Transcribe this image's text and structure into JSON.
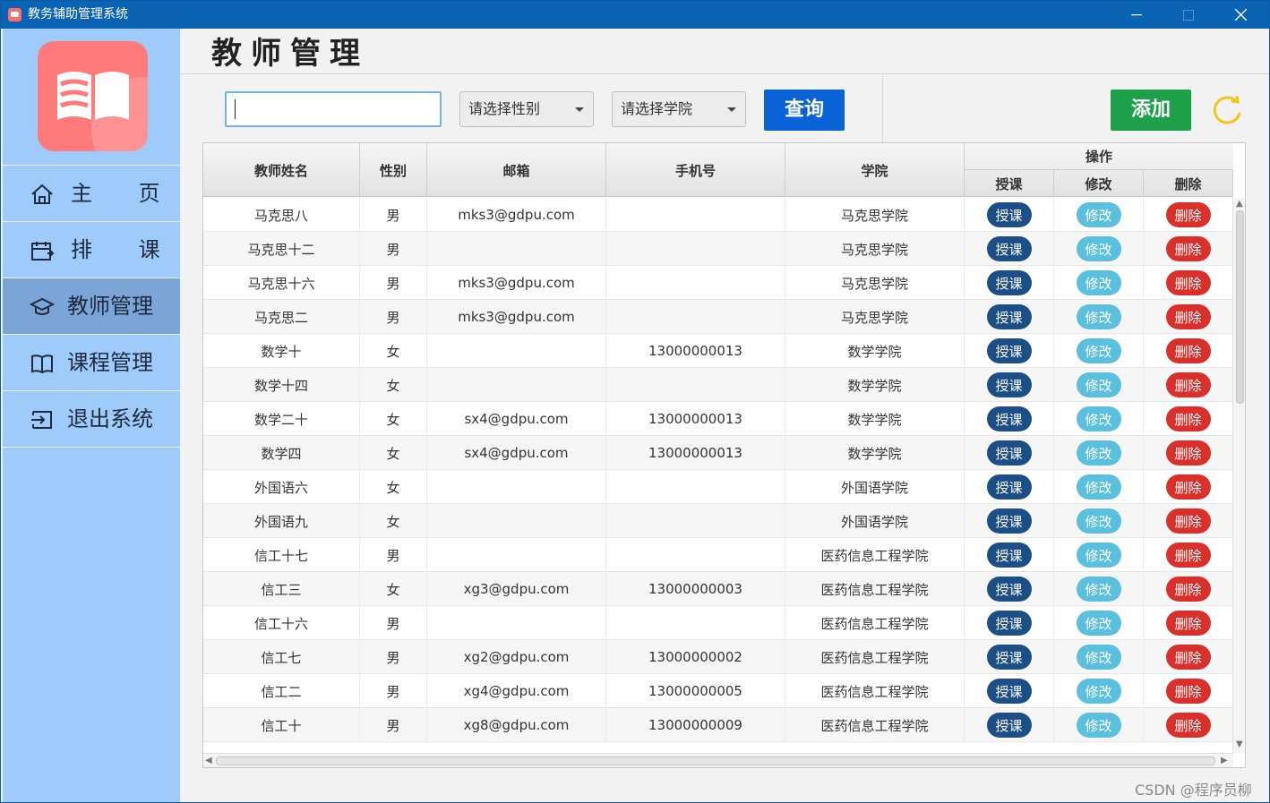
{
  "window": {
    "title": "教务辅助管理系统"
  },
  "sidebar": {
    "items": [
      {
        "label": "主 页",
        "icon": "home-icon"
      },
      {
        "label": "排 课",
        "icon": "schedule-icon"
      },
      {
        "label": "教师管理",
        "icon": "graduation-cap-icon",
        "active": true
      },
      {
        "label": "课程管理",
        "icon": "book-icon"
      },
      {
        "label": "退出系统",
        "icon": "logout-icon"
      }
    ]
  },
  "page": {
    "title": "教师管理"
  },
  "toolbar": {
    "search_value": "",
    "gender_select": "请选择性别",
    "college_select": "请选择学院",
    "query_label": "查询",
    "add_label": "添加",
    "refresh_icon": "refresh-icon"
  },
  "table": {
    "headers": {
      "name": "教师姓名",
      "gender": "性别",
      "email": "邮箱",
      "phone": "手机号",
      "college": "学院",
      "ops": "操作",
      "assign": "授课",
      "edit": "修改",
      "delete": "删除"
    },
    "action_labels": {
      "assign": "授课",
      "edit": "修改",
      "delete": "删除"
    },
    "rows": [
      {
        "name": "马克思八",
        "gender": "男",
        "email": "mks3@gdpu.com",
        "phone": "",
        "college": "马克思学院"
      },
      {
        "name": "马克思十二",
        "gender": "男",
        "email": "",
        "phone": "",
        "college": "马克思学院"
      },
      {
        "name": "马克思十六",
        "gender": "男",
        "email": "mks3@gdpu.com",
        "phone": "",
        "college": "马克思学院"
      },
      {
        "name": "马克思二",
        "gender": "男",
        "email": "mks3@gdpu.com",
        "phone": "",
        "college": "马克思学院"
      },
      {
        "name": "数学十",
        "gender": "女",
        "email": "",
        "phone": "13000000013",
        "college": "数学学院"
      },
      {
        "name": "数学十四",
        "gender": "女",
        "email": "",
        "phone": "",
        "college": "数学学院"
      },
      {
        "name": "数学二十",
        "gender": "女",
        "email": "sx4@gdpu.com",
        "phone": "13000000013",
        "college": "数学学院"
      },
      {
        "name": "数学四",
        "gender": "女",
        "email": "sx4@gdpu.com",
        "phone": "13000000013",
        "college": "数学学院"
      },
      {
        "name": "外国语六",
        "gender": "女",
        "email": "",
        "phone": "",
        "college": "外国语学院"
      },
      {
        "name": "外国语九",
        "gender": "女",
        "email": "",
        "phone": "",
        "college": "外国语学院"
      },
      {
        "name": "信工十七",
        "gender": "男",
        "email": "",
        "phone": "",
        "college": "医药信息工程学院"
      },
      {
        "name": "信工三",
        "gender": "女",
        "email": "xg3@gdpu.com",
        "phone": "13000000003",
        "college": "医药信息工程学院"
      },
      {
        "name": "信工十六",
        "gender": "男",
        "email": "",
        "phone": "",
        "college": "医药信息工程学院"
      },
      {
        "name": "信工七",
        "gender": "男",
        "email": "xg2@gdpu.com",
        "phone": "13000000002",
        "college": "医药信息工程学院"
      },
      {
        "name": "信工二",
        "gender": "男",
        "email": "xg4@gdpu.com",
        "phone": "13000000005",
        "college": "医药信息工程学院"
      },
      {
        "name": "信工十",
        "gender": "男",
        "email": "xg8@gdpu.com",
        "phone": "13000000009",
        "college": "医药信息工程学院"
      }
    ]
  },
  "watermark": "CSDN @程序员柳",
  "colors": {
    "titlebar": "#0b63b3",
    "sidebar": "#9ecbfa",
    "sidebar_active": "#7aa5d6",
    "query_button": "#0a63d6",
    "add_button": "#1ea04a",
    "assign_pill": "#1d4f87",
    "edit_pill": "#5bc0de",
    "delete_pill": "#d9302b",
    "refresh": "#f5c518"
  }
}
